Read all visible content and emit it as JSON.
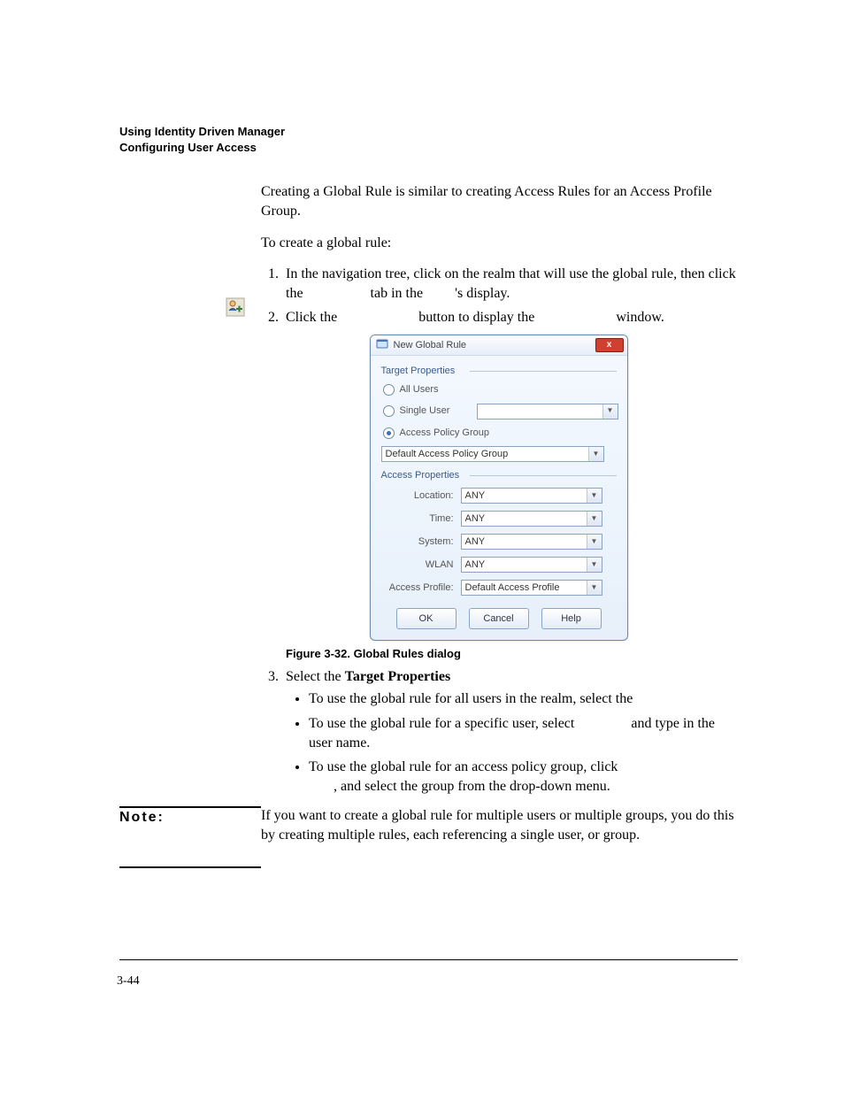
{
  "header": {
    "line1": "Using Identity Driven Manager",
    "line2": "Configuring User Access"
  },
  "intro": "Creating a Global Rule is similar to creating Access Rules for an Access Profile Group.",
  "lead": "To create a global rule:",
  "step1": "In the navigation tree, click on the realm that will use the global rule, then click the",
  "step1b": "tab in the",
  "step1c": "'s display.",
  "step2a": "Click the",
  "step2b": "button to display the",
  "step2c": "window.",
  "dialog": {
    "title": "New Global Rule",
    "close": "x",
    "target_label": "Target Properties",
    "radio_all": "All Users",
    "radio_single": "Single User",
    "radio_apg": "Access Policy Group",
    "apg_value": "Default Access Policy Group",
    "access_label": "Access Properties",
    "fields": {
      "location": {
        "label": "Location:",
        "value": "ANY"
      },
      "time": {
        "label": "Time:",
        "value": "ANY"
      },
      "system": {
        "label": "System:",
        "value": "ANY"
      },
      "wlan": {
        "label": "WLAN",
        "value": "ANY"
      },
      "profile": {
        "label": "Access Profile:",
        "value": "Default Access Profile"
      }
    },
    "buttons": {
      "ok": "OK",
      "cancel": "Cancel",
      "help": "Help"
    }
  },
  "fig_caption": "Figure 3-32. Global Rules dialog",
  "step3_lead": "Select the ",
  "step3_bold": "Target Properties",
  "bullets": {
    "b1": "To use the global rule for all users in the realm, select the",
    "b2a": "To use the global rule for a specific user, select",
    "b2b": "and type in the user name.",
    "b3a": "To use the global rule for an access policy group, click",
    "b3b": ", and select the group from the drop-down menu."
  },
  "note": {
    "label": "Note:",
    "body": "If you want to create a global rule for multiple users or multiple groups, you do this by creating multiple rules, each referencing a single user, or group."
  },
  "page_number": "3-44"
}
